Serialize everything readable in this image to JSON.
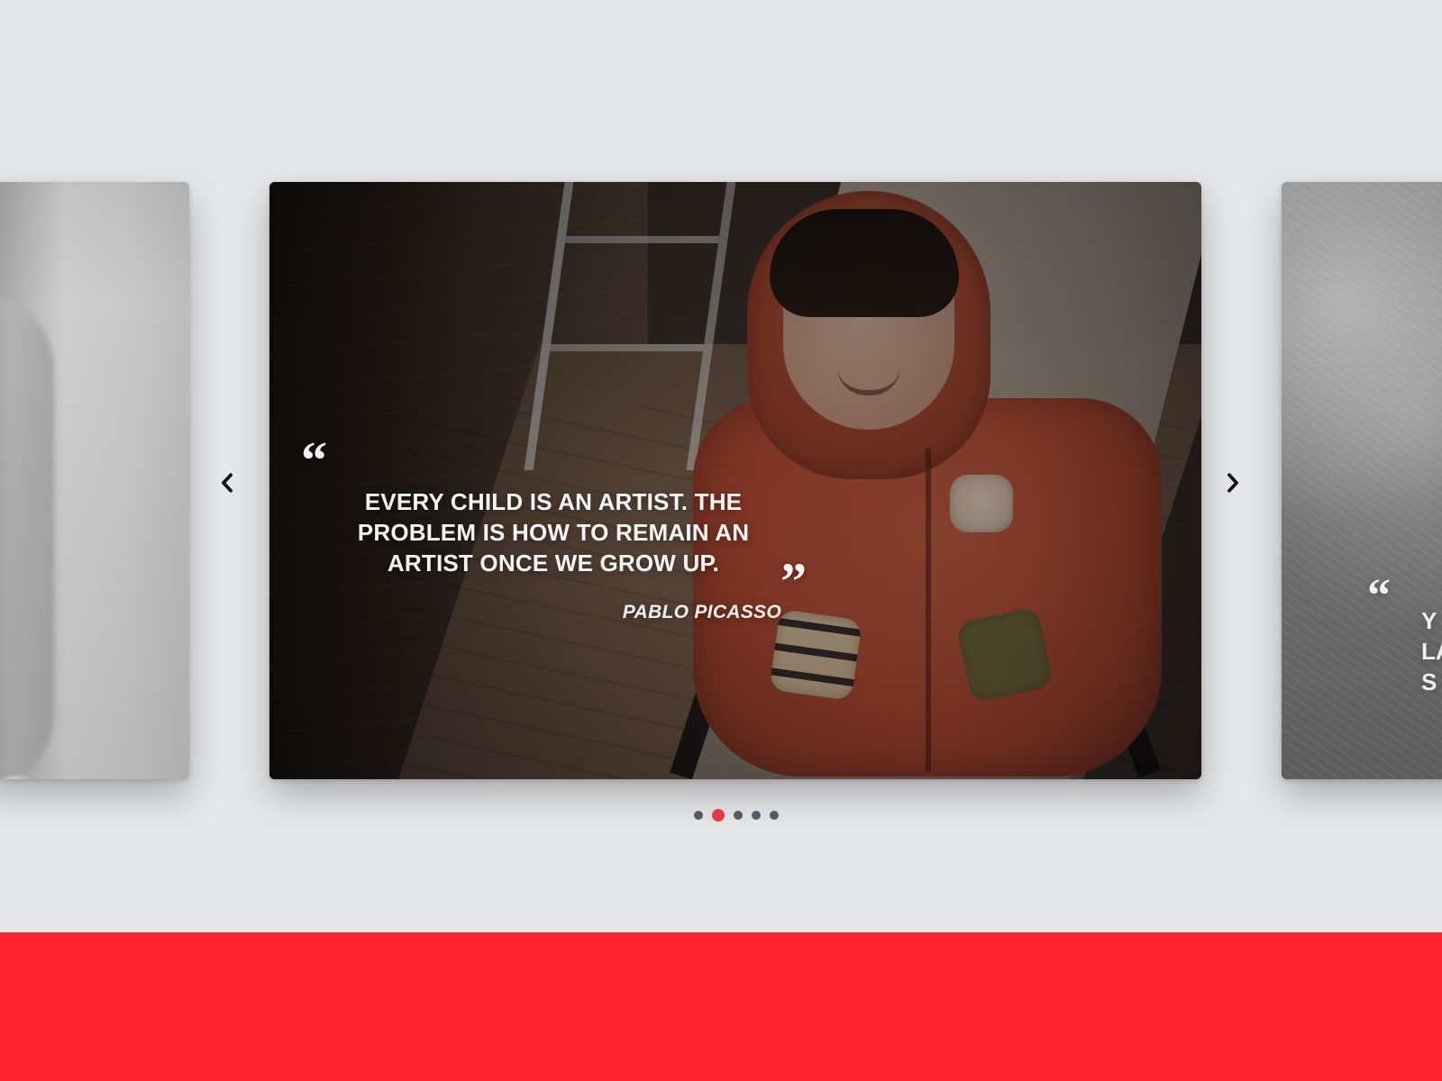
{
  "carousel": {
    "main_slide": {
      "quote": "EVERY CHILD IS AN ARTIST. THE PROBLEM IS HOW TO REMAIN AN ARTIST ONCE WE GROW UP.",
      "author": "PABLO PICASSO",
      "open_quote_mark": "“",
      "close_quote_mark": "”"
    },
    "next_slide_preview": {
      "quote_mark": "“",
      "text_fragment": "Y\nLA\nS"
    },
    "navigation": {
      "prev_icon": "chevron-left-icon",
      "next_icon": "chevron-right-icon",
      "dots_count": 5,
      "active_dot_index": 1
    }
  },
  "colors": {
    "page_background": "#e6e7e9",
    "footer_red": "#ff222c",
    "active_dot": "#e53b44",
    "inactive_dot": "#555a60",
    "arrow": "#111111"
  }
}
